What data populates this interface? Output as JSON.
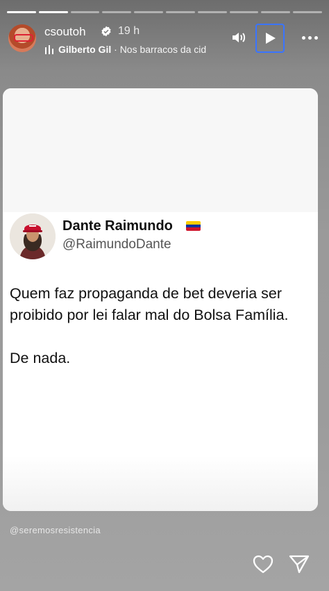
{
  "story": {
    "username": "csoutoh",
    "time": "19 h",
    "progress_segments": 10,
    "progress_active": 2
  },
  "music": {
    "artist": "Gilberto Gil",
    "separator": " · ",
    "song": "Nos barracos da cid"
  },
  "tweet": {
    "name": "Dante Raimundo",
    "handle": "@RaimundoDante",
    "paragraphs": [
      "Quem faz propaganda de bet deveria ser proibido por lei falar mal do Bolsa Família.",
      "De nada."
    ]
  },
  "footer": {
    "watermark": "@seremosresistencia"
  },
  "icons": {
    "verified": "verified-badge-icon",
    "music": "music-bars-icon",
    "volume": "volume-icon",
    "play": "play-icon",
    "more": "more-dots-icon",
    "like": "heart-icon",
    "share": "send-icon",
    "flag": "venezuela-flag-icon"
  },
  "colors": {
    "play_outline": "#3a74ff",
    "flag": [
      "#ffcc00",
      "#0033a0",
      "#cf142b"
    ]
  }
}
